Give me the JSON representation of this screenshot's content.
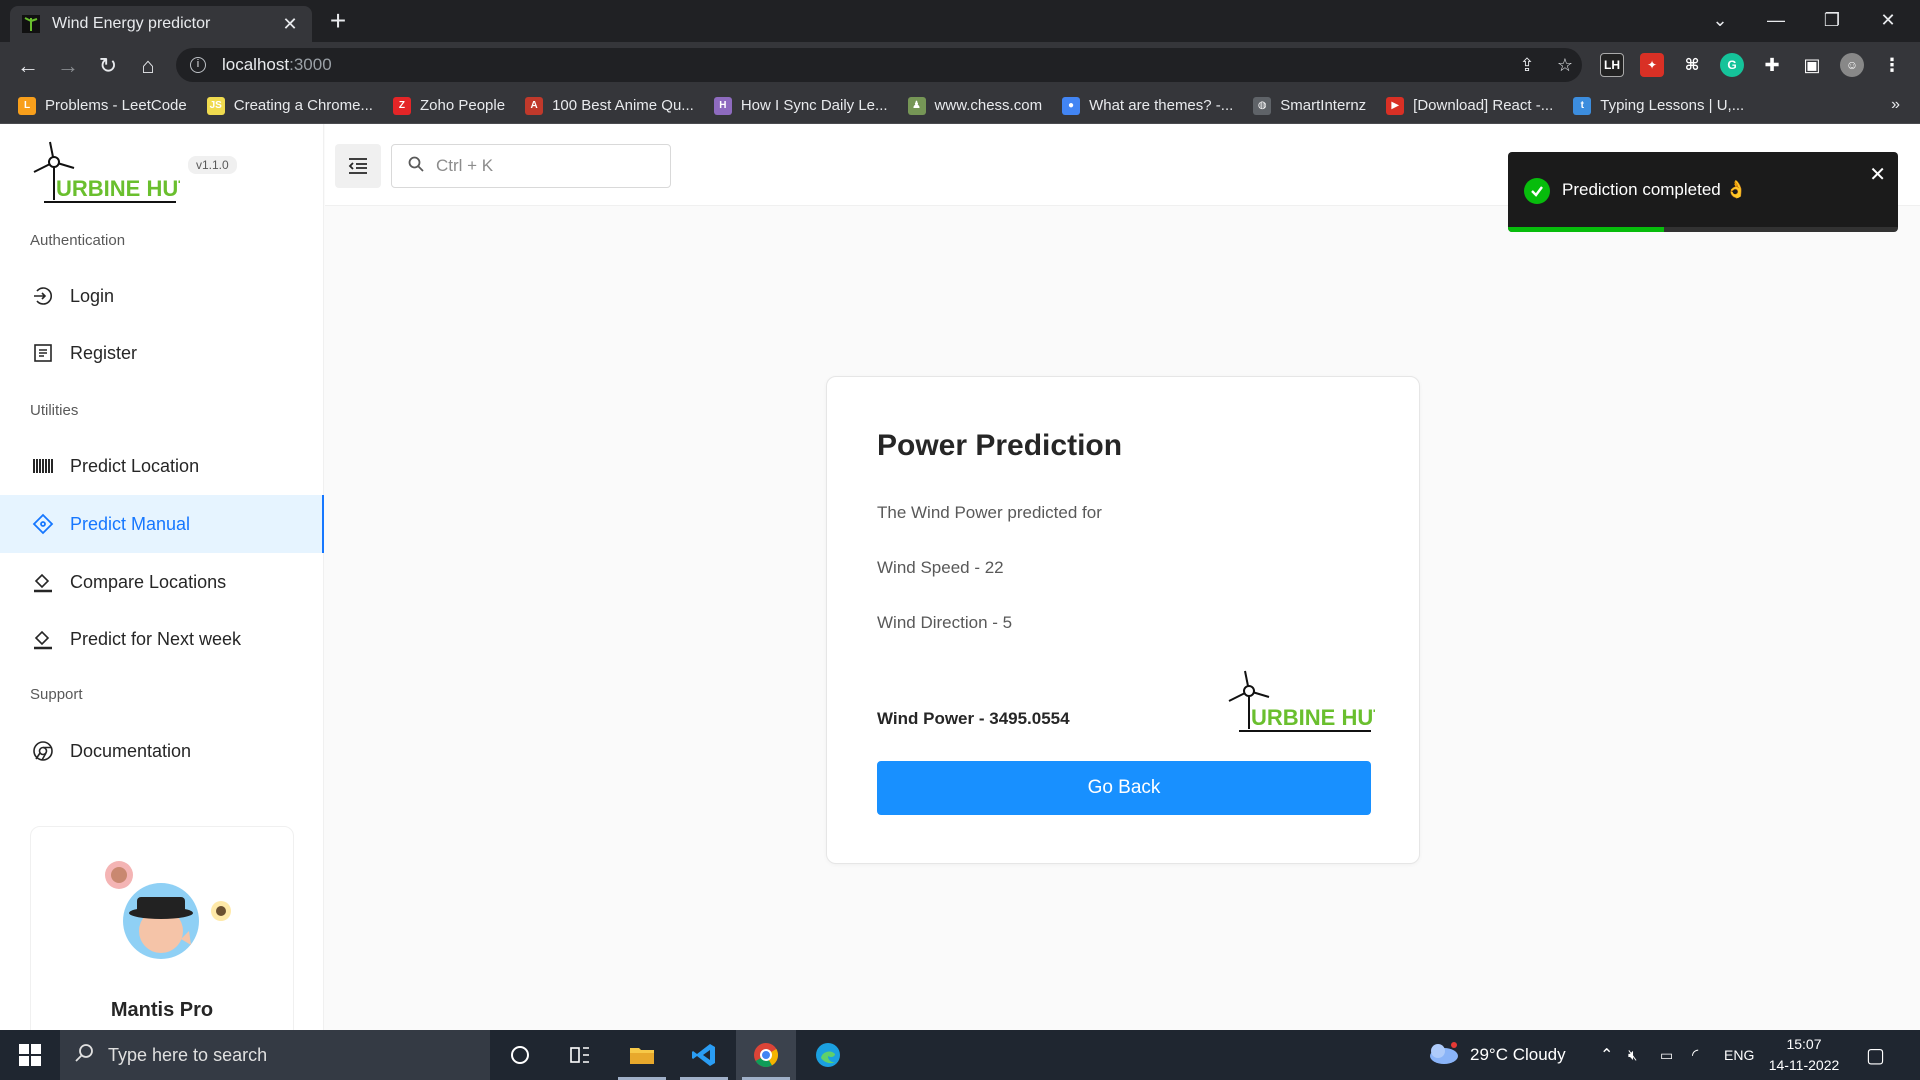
{
  "browser": {
    "tab_title": "Wind Energy predictor",
    "url_host": "localhost",
    "url_port": ":3000",
    "bookmarks": [
      {
        "label": "Problems - LeetCode",
        "icon": "leetcode-icon",
        "color": "#f89f1b",
        "glyph": "L"
      },
      {
        "label": "Creating a Chrome...",
        "icon": "js-icon",
        "color": "#f0db4f",
        "glyph": "JS"
      },
      {
        "label": "Zoho People",
        "icon": "zoho-icon",
        "color": "#e42527",
        "glyph": "Z"
      },
      {
        "label": "100 Best Anime Qu...",
        "icon": "anime-icon",
        "color": "#c0392b",
        "glyph": "A"
      },
      {
        "label": "How I Sync Daily Le...",
        "icon": "sync-icon",
        "color": "#8e6bbf",
        "glyph": "H"
      },
      {
        "label": "www.chess.com",
        "icon": "chess-icon",
        "color": "#769656",
        "glyph": "♟"
      },
      {
        "label": "What are themes? -...",
        "icon": "chrome-icon",
        "color": "#4285f4",
        "glyph": "●"
      },
      {
        "label": "SmartInternz",
        "icon": "globe-icon",
        "color": "#5f6368",
        "glyph": "◍"
      },
      {
        "label": "[Download] React -...",
        "icon": "download-icon",
        "color": "#d93025",
        "glyph": "▶"
      },
      {
        "label": "Typing Lessons | U,...",
        "icon": "typing-icon",
        "color": "#3c8dde",
        "glyph": "t"
      }
    ]
  },
  "app": {
    "logo_text": "URBINE HUT",
    "version": "v1.1.0",
    "search_placeholder": "Ctrl + K",
    "nav_groups": {
      "authentication": "Authentication",
      "utilities": "Utilities",
      "support": "Support"
    },
    "nav_items": {
      "login": "Login",
      "register": "Register",
      "predict_location": "Predict Location",
      "predict_manual": "Predict Manual",
      "compare_locations": "Compare Locations",
      "predict_next_week": "Predict for Next week",
      "documentation": "Documentation"
    },
    "promo_name": "Mantis Pro"
  },
  "card": {
    "title": "Power Prediction",
    "intro": "The Wind Power predicted for",
    "wind_speed": "Wind Speed - 22",
    "wind_direction": "Wind Direction - 5",
    "wind_power": "Wind Power - 3495.0554",
    "go_back": "Go Back"
  },
  "toast": {
    "message": "Prediction completed 👌",
    "progress": 0.4,
    "color": "#07bc0c"
  },
  "taskbar": {
    "search_placeholder": "Type here to search",
    "weather": "29°C  Cloudy",
    "language": "ENG",
    "time": "15:07",
    "date": "14-11-2022"
  },
  "colors": {
    "accent": "#1677ff",
    "button": "#1890ff",
    "active_bg": "#e6f4ff",
    "logo_green": "#6abf2e"
  }
}
